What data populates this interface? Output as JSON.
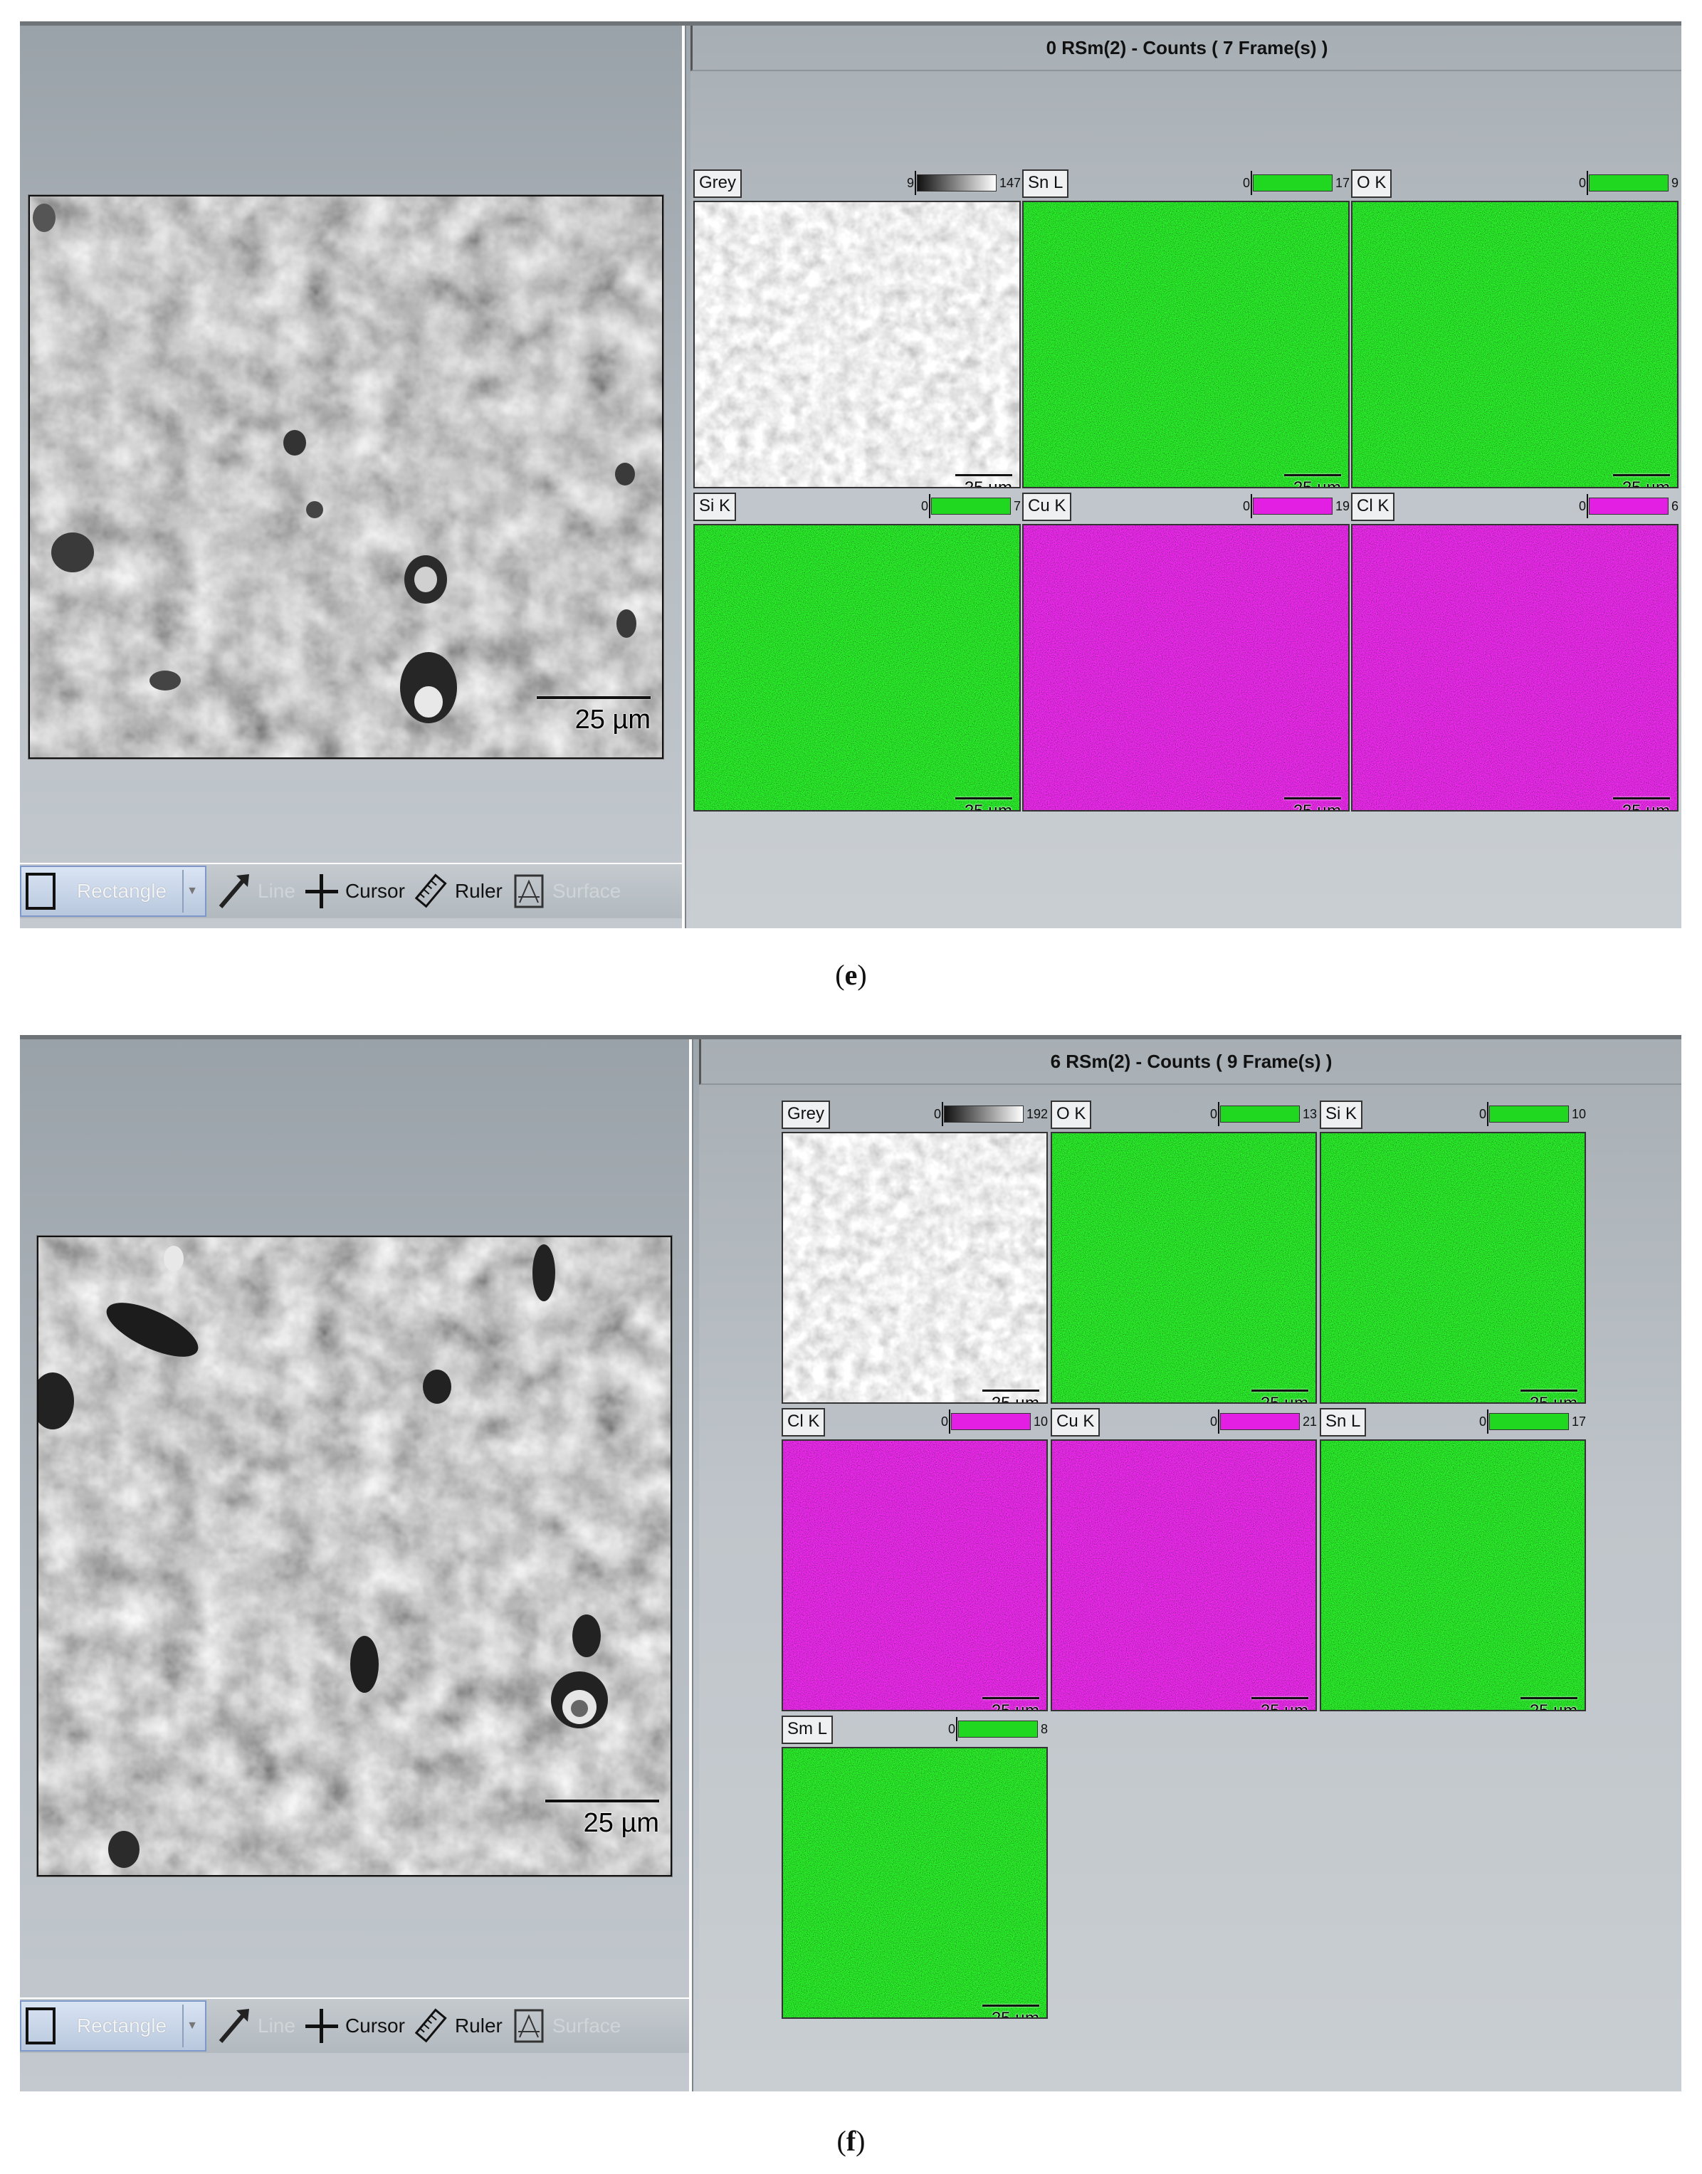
{
  "panel_e": {
    "caption_letter": "e",
    "header": "0 RSm(2) - Counts ( 7 Frame(s) )",
    "sem_scale": "25 µm",
    "tiles": [
      {
        "label": "Grey",
        "min": "9",
        "max": "147",
        "color": "#808080",
        "scale": "25 µm"
      },
      {
        "label": "Sn L",
        "min": "0",
        "max": "17",
        "color": "#1fd81f",
        "scale": "25 µm"
      },
      {
        "label": "O K",
        "min": "0",
        "max": "9",
        "color": "#1fd81f",
        "scale": "25 µm"
      },
      {
        "label": "Si K",
        "min": "0",
        "max": "7",
        "color": "#1fd81f",
        "scale": "25 µm"
      },
      {
        "label": "Cu K",
        "min": "0",
        "max": "19",
        "color": "#e21fe2",
        "scale": "25 µm"
      },
      {
        "label": "Cl K",
        "min": "0",
        "max": "6",
        "color": "#e21fe2",
        "scale": "25 µm"
      }
    ],
    "toolbar": {
      "rectangle": "Rectangle",
      "line": "Line",
      "cursor": "Cursor",
      "ruler": "Ruler",
      "surface": "Surface"
    }
  },
  "panel_f": {
    "caption_letter": "f",
    "header": "6 RSm(2) - Counts ( 9 Frame(s) )",
    "sem_scale": "25 µm",
    "tiles": [
      {
        "label": "Grey",
        "min": "0",
        "max": "192",
        "color": "#808080",
        "scale": "25 µm"
      },
      {
        "label": "O K",
        "min": "0",
        "max": "13",
        "color": "#1fd81f",
        "scale": "25 µm"
      },
      {
        "label": "Si K",
        "min": "0",
        "max": "10",
        "color": "#1fd81f",
        "scale": "25 µm"
      },
      {
        "label": "Cl K",
        "min": "0",
        "max": "10",
        "color": "#e21fe2",
        "scale": "25 µm"
      },
      {
        "label": "Cu K",
        "min": "0",
        "max": "21",
        "color": "#e21fe2",
        "scale": "25 µm"
      },
      {
        "label": "Sn L",
        "min": "0",
        "max": "17",
        "color": "#1fd81f",
        "scale": "25 µm"
      },
      {
        "label": "Sm L",
        "min": "0",
        "max": "8",
        "color": "#1fd81f",
        "scale": "25 µm"
      }
    ],
    "toolbar": {
      "rectangle": "Rectangle",
      "line": "Line",
      "cursor": "Cursor",
      "ruler": "Ruler",
      "surface": "Surface"
    }
  }
}
